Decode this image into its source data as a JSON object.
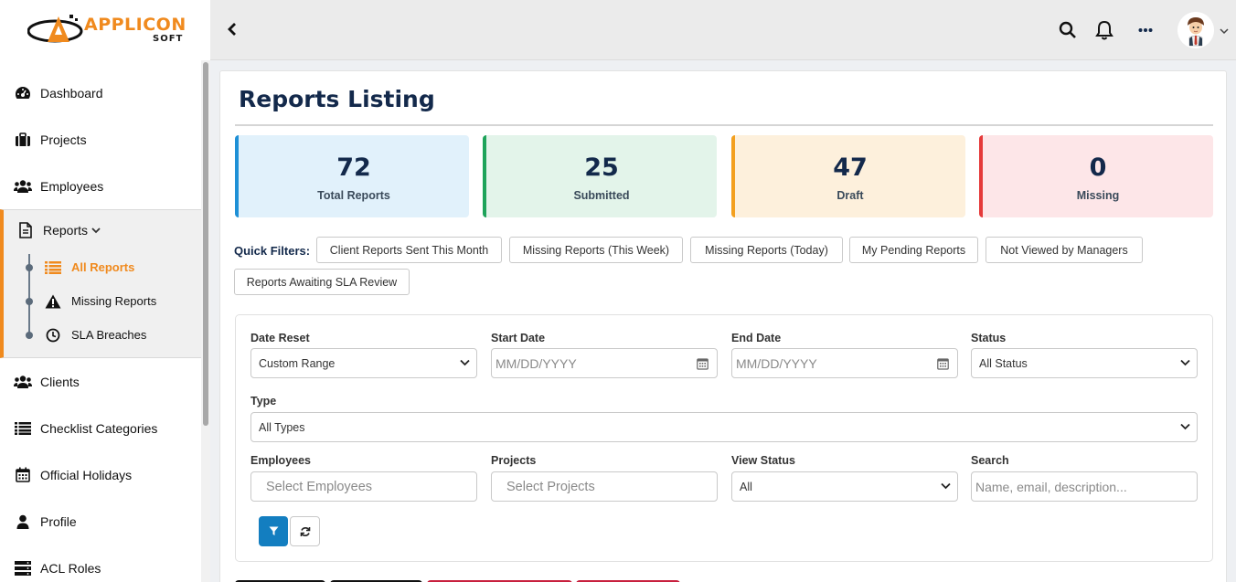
{
  "brand": {
    "name": "APPLICON",
    "sub": "SOFT",
    "accent": "#f08a1e"
  },
  "sidebar": {
    "items": [
      {
        "label": "Dashboard",
        "icon": "dashboard-icon"
      },
      {
        "label": "Projects",
        "icon": "briefcase-icon"
      },
      {
        "label": "Employees",
        "icon": "users-icon"
      },
      {
        "label": "Reports",
        "icon": "document-icon"
      },
      {
        "label": "Clients",
        "icon": "users-icon"
      },
      {
        "label": "Checklist Categories",
        "icon": "list-icon"
      },
      {
        "label": "Official Holidays",
        "icon": "calendar-icon"
      },
      {
        "label": "Profile",
        "icon": "user-icon"
      },
      {
        "label": "ACL Roles",
        "icon": "server-icon"
      }
    ],
    "reports_sub": [
      {
        "label": "All Reports",
        "icon": "list-icon"
      },
      {
        "label": "Missing Reports",
        "icon": "warning-icon"
      },
      {
        "label": "SLA Breaches",
        "icon": "clock-icon"
      }
    ]
  },
  "page": {
    "title": "Reports Listing"
  },
  "stats": [
    {
      "value": "72",
      "label": "Total Reports",
      "bg": "#e1f1fb",
      "border": "#1e90d6"
    },
    {
      "value": "25",
      "label": "Submitted",
      "bg": "#e3f4ea",
      "border": "#1ea35a"
    },
    {
      "value": "47",
      "label": "Draft",
      "bg": "#fdf0dc",
      "border": "#f3a01f"
    },
    {
      "value": "0",
      "label": "Missing",
      "bg": "#fde6e8",
      "border": "#e53a3a"
    }
  ],
  "quick_filters": {
    "label": "Quick Filters:",
    "chips": [
      "Client Reports Sent This Month",
      "Missing Reports (This Week)",
      "Missing Reports (Today)",
      "My Pending Reports",
      "Not Viewed by Managers",
      "Reports Awaiting SLA Review"
    ]
  },
  "filters": {
    "date_reset": {
      "label": "Date Reset",
      "value": "Custom Range"
    },
    "start_date": {
      "label": "Start Date",
      "placeholder": "MM/DD/YYYY"
    },
    "end_date": {
      "label": "End Date",
      "placeholder": "MM/DD/YYYY"
    },
    "status": {
      "label": "Status",
      "value": "All Status"
    },
    "type": {
      "label": "Type",
      "value": "All Types"
    },
    "employees": {
      "label": "Employees",
      "placeholder": "Select Employees"
    },
    "projects": {
      "label": "Projects",
      "placeholder": "Select Projects"
    },
    "view_status": {
      "label": "View Status",
      "value": "All"
    },
    "search": {
      "label": "Search",
      "placeholder": "Name, email, description..."
    }
  },
  "colors": {
    "primary_button": "#137ec0",
    "title": "#13294b"
  }
}
